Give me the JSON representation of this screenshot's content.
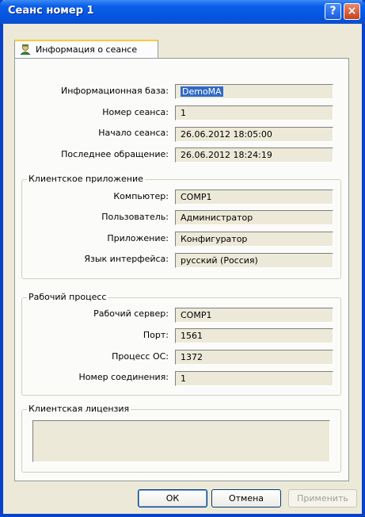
{
  "window": {
    "title": "Сеанс номер 1",
    "help_glyph": "?",
    "close_glyph": "×"
  },
  "tabs": [
    {
      "label": "Информация о сеансе",
      "selected": true
    }
  ],
  "session": {
    "infobase_label": "Информационная база:",
    "infobase_value": "DemoMA",
    "number_label": "Номер сеанса:",
    "number_value": "1",
    "start_label": "Начало сеанса:",
    "start_value": "26.06.2012 18:05:00",
    "last_label": "Последнее обращение:",
    "last_value": "26.06.2012 18:24:19"
  },
  "client_app": {
    "legend": "Клиентское приложение",
    "computer_label": "Компьютер:",
    "computer_value": "COMP1",
    "user_label": "Пользователь:",
    "user_value": "Администратор",
    "app_label": "Приложение:",
    "app_value": "Конфигуратор",
    "lang_label": "Язык интерфейса:",
    "lang_value": "русский (Россия)"
  },
  "worker": {
    "legend": "Рабочий процесс",
    "server_label": "Рабочий сервер:",
    "server_value": "COMP1",
    "port_label": "Порт:",
    "port_value": "1561",
    "pid_label": "Процесс ОС:",
    "pid_value": "1372",
    "conn_label": "Номер соединения:",
    "conn_value": "1"
  },
  "license": {
    "legend": "Клиентская лицензия",
    "value": ""
  },
  "buttons": {
    "ok": "ОК",
    "cancel": "Отмена",
    "apply": "Применить"
  }
}
